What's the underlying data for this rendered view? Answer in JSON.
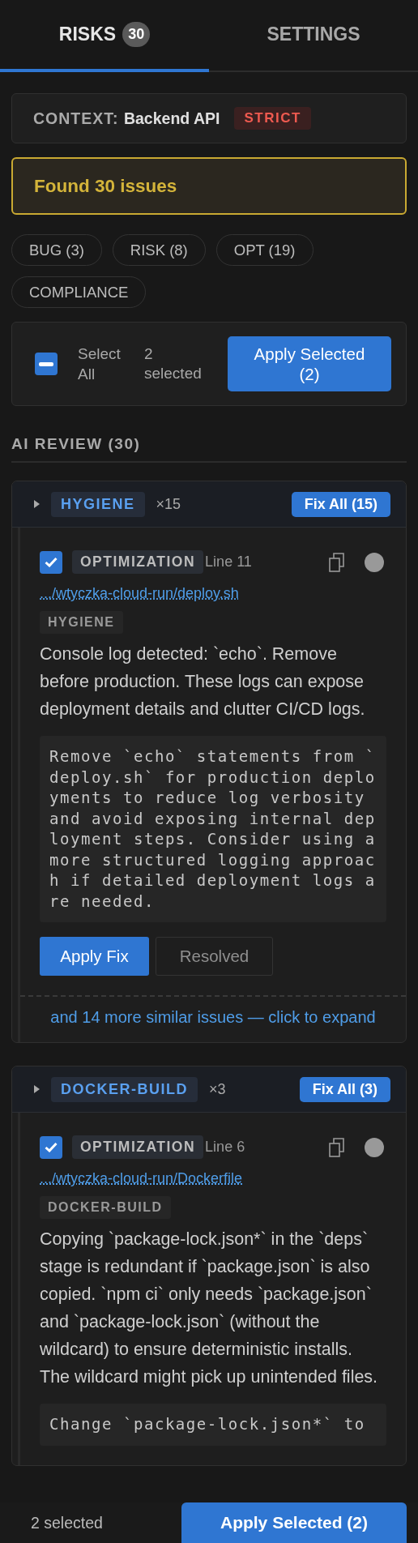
{
  "tabs": [
    {
      "label": "RISKS",
      "badge": "30",
      "selected": true
    },
    {
      "label": "SETTINGS",
      "selected": false
    }
  ],
  "context": {
    "label": "CONTEXT:",
    "value": "Backend API",
    "mode": "STRICT"
  },
  "alert": "Found 30 issues",
  "filters": [
    "BUG (3)",
    "RISK (8)",
    "OPT (19)",
    "COMPLIANCE"
  ],
  "bulk": {
    "select_all": {
      "label": "Select All",
      "indeterminate": true
    },
    "count": "2 selected",
    "button": "Apply Selected (2)"
  },
  "review": {
    "title": "AI REVIEW (30)",
    "groups": [
      {
        "tag": "HYGIENE",
        "count": "×15",
        "fix": "Fix All (15)",
        "expanded": false,
        "items": [
          {
            "checked": true,
            "type": "OPTIMIZATION",
            "line": "Line 11",
            "file": ".../wtyczka-cloud-run/deploy.sh",
            "category": "HYGIENE",
            "description": "Console log detected: `echo`. Remove before production. These logs can expose deployment details and clutter CI/CD logs.",
            "suggestion": "Remove `echo` statements from `deploy.sh` for production deployments to reduce log verbosity and avoid exposing internal deployment steps. Consider using a more structured logging approach if detailed deployment logs are needed.",
            "actions": [
              {
                "label": "Apply Fix",
                "kind": "primary"
              },
              {
                "label": "Resolved",
                "kind": "secondary"
              }
            ]
          }
        ],
        "more": "and 14 more similar issues — click to expand"
      },
      {
        "tag": "DOCKER-BUILD",
        "count": "×3",
        "fix": "Fix All (3)",
        "expanded": false,
        "items": [
          {
            "checked": true,
            "type": "OPTIMIZATION",
            "line": "Line 6",
            "file": ".../wtyczka-cloud-run/Dockerfile",
            "category": "DOCKER-BUILD",
            "description": "Copying `package-lock.json*` in the `deps` stage is redundant if `package.json` is also copied. `npm ci` only needs `package.json` and `package-lock.json` (without the wildcard) to ensure deterministic installs. The wildcard might pick up unintended files.",
            "suggestion": "Change `package-lock.json*` to"
          }
        ]
      }
    ]
  },
  "footer": {
    "count": "2 selected",
    "button": "Apply Selected (2)"
  }
}
